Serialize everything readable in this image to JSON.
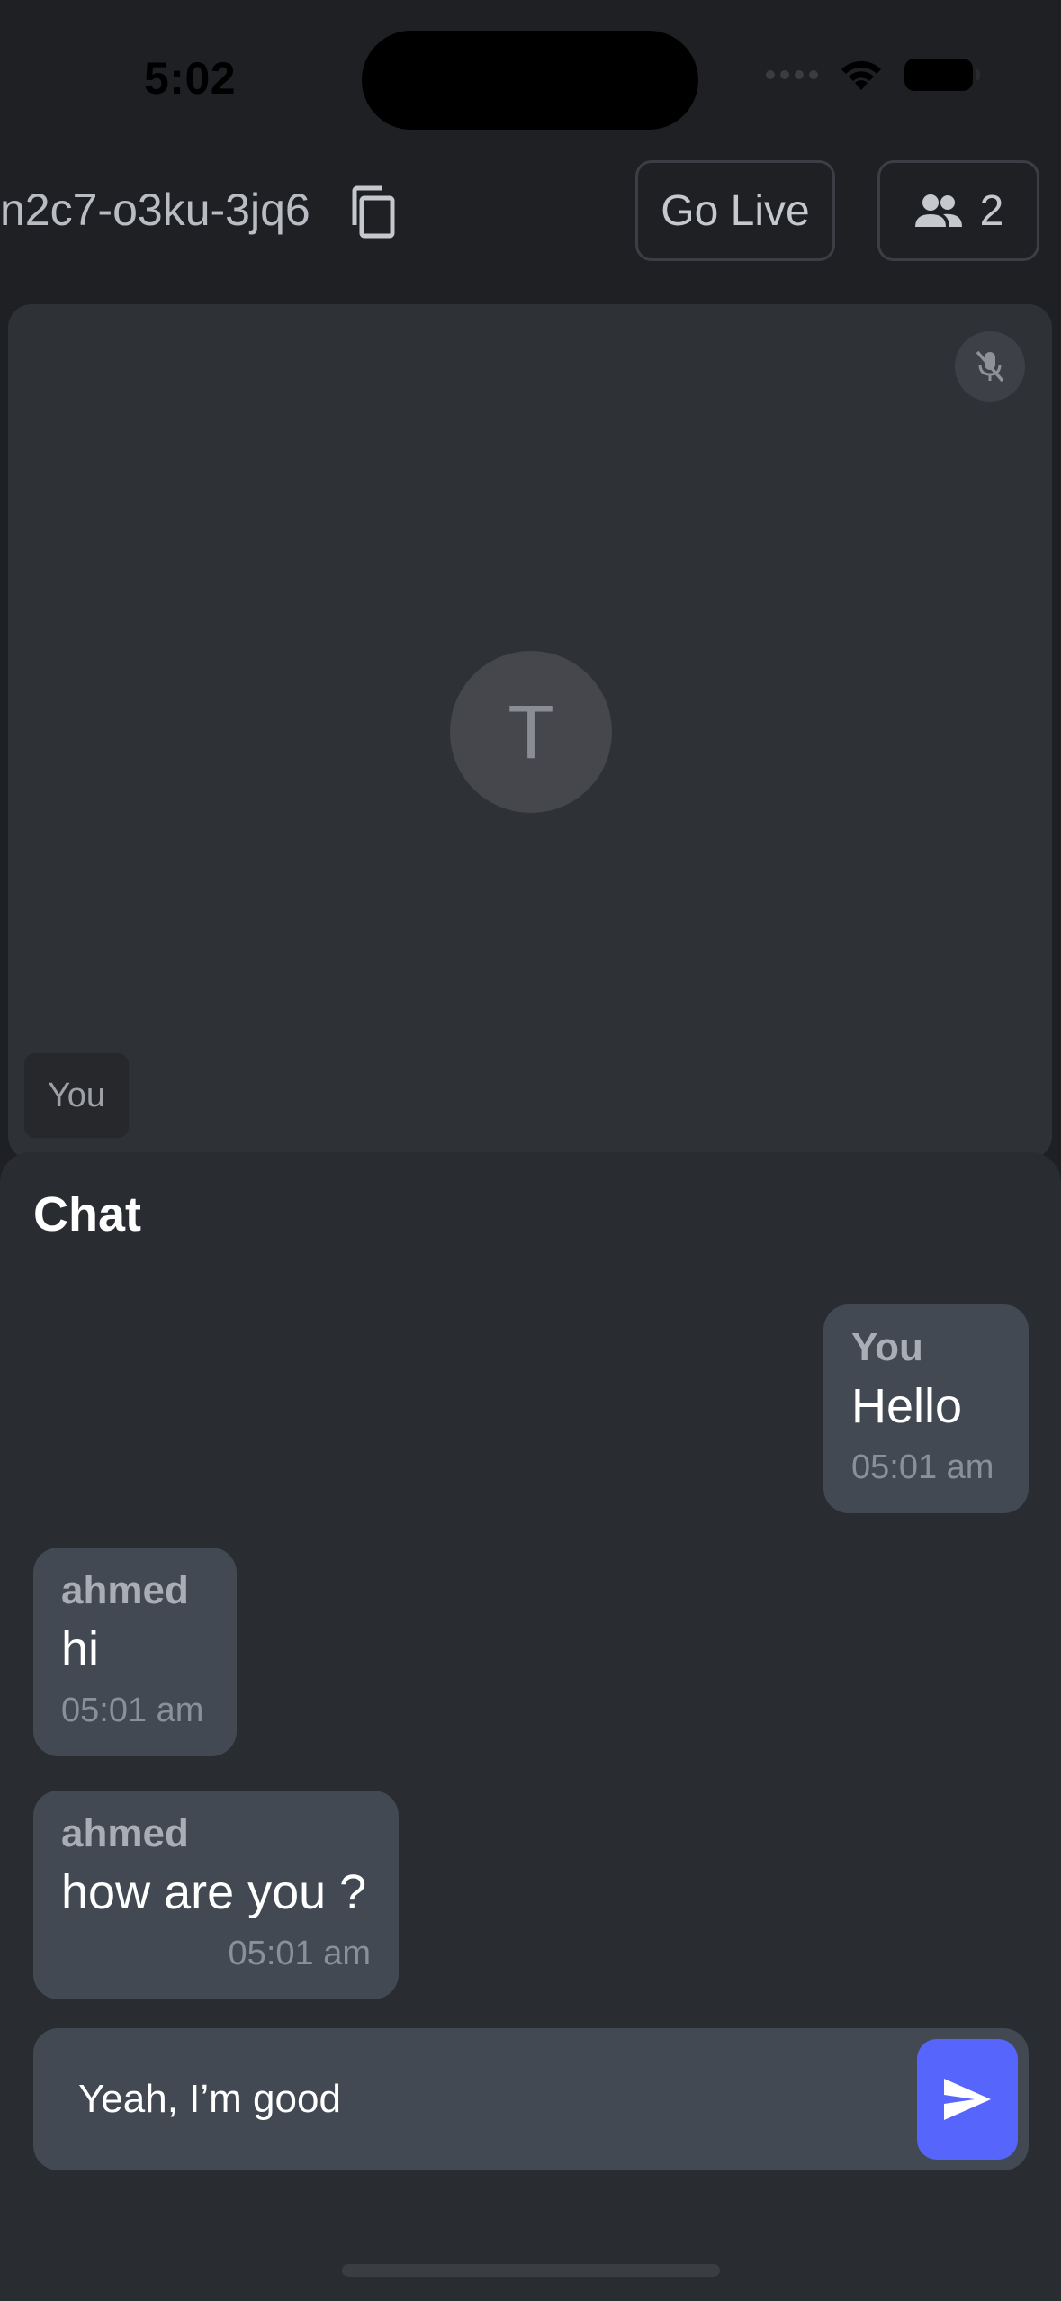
{
  "status_bar": {
    "time": "5:02"
  },
  "header": {
    "meeting_code": "n2c7-o3ku-3jq6",
    "go_live_label": "Go Live",
    "participant_count": "2",
    "icons": [
      "copy-icon",
      "people-icon"
    ]
  },
  "video": {
    "avatar_initial": "T",
    "participant_name": "You",
    "mic_state": "muted"
  },
  "chat": {
    "title": "Chat",
    "messages": [
      {
        "sender": "You",
        "text": "Hello",
        "time": "05:01 am"
      },
      {
        "sender": "ahmed",
        "text": "hi",
        "time": "05:01 am"
      },
      {
        "sender": "ahmed",
        "text": "how are you ?",
        "time": "05:01 am"
      }
    ],
    "composer": {
      "value": "Yeah, I’m good"
    }
  },
  "colors": {
    "accent": "#5665fb",
    "background": "#1e2024",
    "chat_panel": "#292d32",
    "bubble": "#424952"
  }
}
